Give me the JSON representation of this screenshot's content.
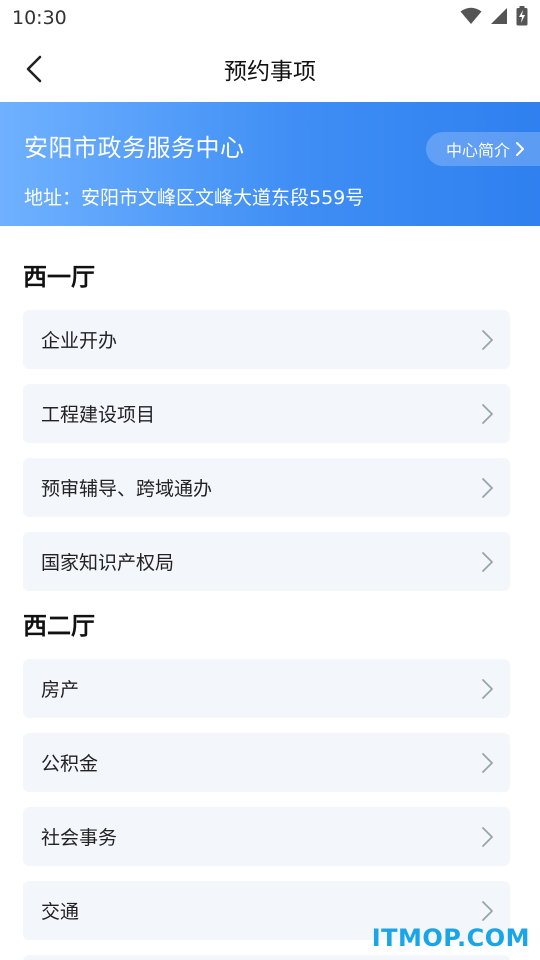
{
  "status_bar": {
    "time": "10:30",
    "icons": [
      "wifi-icon",
      "signal-icon",
      "battery-charging-icon"
    ]
  },
  "nav": {
    "title": "预约事项",
    "back_icon": "chevron-left-icon"
  },
  "banner": {
    "title": "安阳市政务服务中心",
    "address": "地址：安阳市文峰区文峰大道东段559号",
    "intro_label": "中心简介",
    "gradient_start": "#6fb1ff",
    "gradient_end": "#2f80f0"
  },
  "sections": [
    {
      "title": "西一厅",
      "items": [
        {
          "label": "企业开办"
        },
        {
          "label": "工程建设项目"
        },
        {
          "label": "预审辅导、跨域通办"
        },
        {
          "label": "国家知识产权局"
        }
      ]
    },
    {
      "title": "西二厅",
      "items": [
        {
          "label": "房产"
        },
        {
          "label": "公积金"
        },
        {
          "label": "社会事务"
        },
        {
          "label": "交通"
        }
      ]
    }
  ],
  "watermark": "ITMOP.COM",
  "colors": {
    "accent": "#3f8ef5",
    "item_bg": "#f3f6fb",
    "watermark": "#1aa5e8"
  }
}
